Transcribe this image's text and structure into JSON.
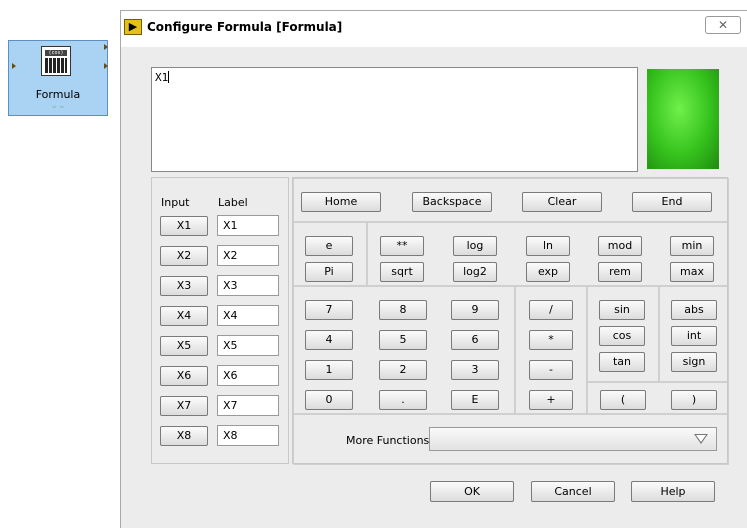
{
  "node": {
    "label": "Formula",
    "icon_text": "(cos)",
    "chevron": "⌄⌄"
  },
  "dialog": {
    "title": "Configure Formula [Formula]",
    "close_glyph": "✕",
    "formula_text": "X1",
    "preview_color": "#3ed321",
    "input_header": "Input",
    "label_header": "Label",
    "inputs": [
      "X1",
      "X2",
      "X3",
      "X4",
      "X5",
      "X6",
      "X7",
      "X8"
    ],
    "labels": [
      "X1",
      "X2",
      "X3",
      "X4",
      "X5",
      "X6",
      "X7",
      "X8"
    ],
    "nav": [
      "Home",
      "Backspace",
      "Clear",
      "End"
    ],
    "consts": [
      "e",
      "Pi"
    ],
    "ops_row1": [
      "**",
      "log",
      "ln",
      "mod",
      "min"
    ],
    "ops_row2": [
      "sqrt",
      "log2",
      "exp",
      "rem",
      "max"
    ],
    "digits": [
      [
        "7",
        "8",
        "9"
      ],
      [
        "4",
        "5",
        "6"
      ],
      [
        "1",
        "2",
        "3"
      ],
      [
        "0",
        ".",
        "E"
      ]
    ],
    "arith": [
      "/",
      "*",
      "-",
      "+"
    ],
    "trig": [
      "sin",
      "cos",
      "tan"
    ],
    "misc": [
      "abs",
      "int",
      "sign"
    ],
    "parens": [
      "(",
      ")"
    ],
    "more_functions_label": "More Functions",
    "more_functions_value": "",
    "ok": "OK",
    "cancel": "Cancel",
    "help": "Help"
  }
}
